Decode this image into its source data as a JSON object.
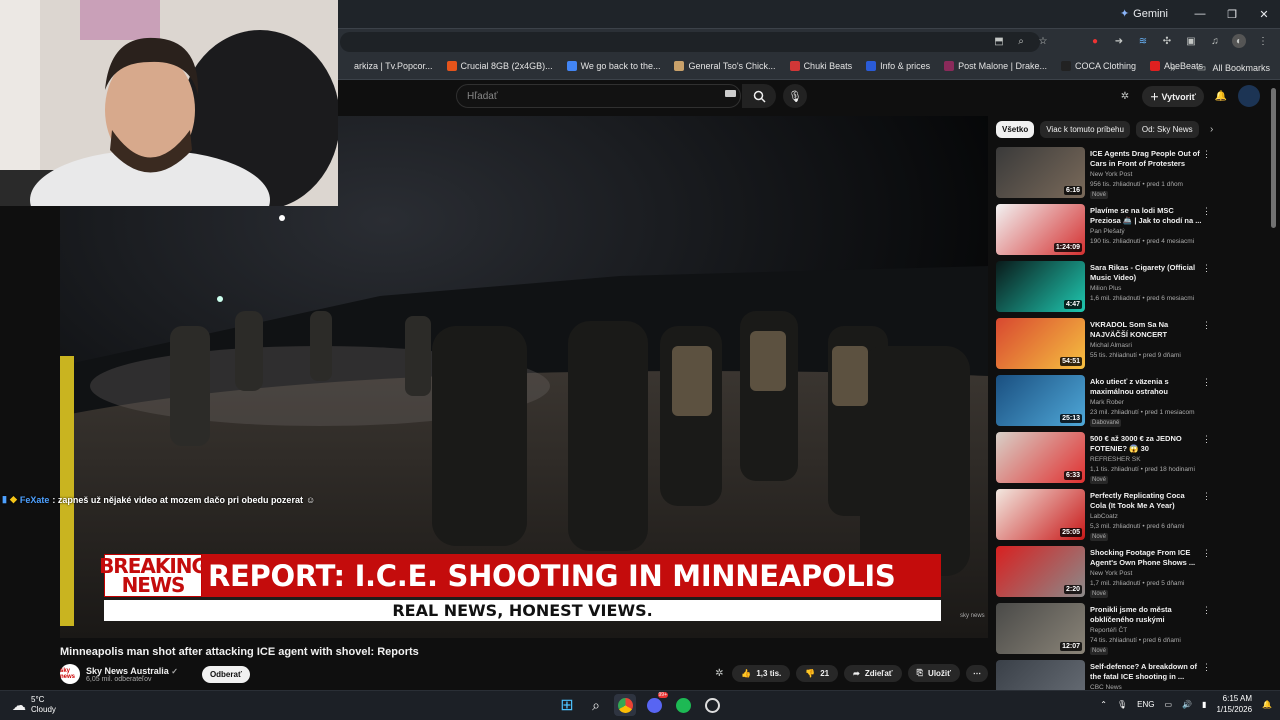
{
  "browser": {
    "gemini_label": "Gemini",
    "bookmarks": [
      {
        "label": "arkiza | Tv.Popcor...",
        "color": "#00000000"
      },
      {
        "label": "Crucial 8GB (2x4GB)...",
        "color": "#e5541b"
      },
      {
        "label": "We go back to the...",
        "color": "#4285f4"
      },
      {
        "label": "General Tso's Chick...",
        "color": "#c9a16a"
      },
      {
        "label": "Chuki Beats",
        "color": "#d23737"
      },
      {
        "label": "Info & prices",
        "color": "#2a5bd7"
      },
      {
        "label": "Post Malone | Drake...",
        "color": "#8a2a5a"
      },
      {
        "label": "COCA Clothing",
        "color": "#222222"
      },
      {
        "label": "AbeBeats",
        "color": "#e02020"
      }
    ],
    "all_bookmarks": "All Bookmarks"
  },
  "youtube": {
    "search_placeholder": "Hľadať",
    "create_label": "Vytvoriť",
    "video": {
      "breaking_line1": "BREAKING",
      "breaking_line2": "NEWS",
      "headline": "REPORT: I.C.E. SHOOTING IN MINNEAPOLIS",
      "tagline": "REAL NEWS, HONEST VIEWS.",
      "watermark": "sky news"
    },
    "chat": {
      "user": "FeXate",
      "message": ": zapneš už nějaké video at mozem dačo pri obedu pozerat"
    },
    "title": "Minneapolis man shot after attacking ICE agent with shovel: Reports",
    "channel": {
      "name": "Sky News Australia",
      "subs": "6,05 mil. odberateľov",
      "avatar_text": "sky news",
      "subscribe": "Odberať"
    },
    "actions": {
      "likes": "1,3 tis.",
      "dislikes": "21",
      "share": "Zdieľať",
      "save": "Uložiť"
    },
    "chips": [
      "Všetko",
      "Viac k tomuto príbehu",
      "Od: Sky News"
    ],
    "recommendations": [
      {
        "title": "ICE Agents Drag People Out of Cars in Front of Protesters",
        "channel": "New York Post",
        "meta": "956 tis. zhliadnutí • pred 1 dňom",
        "badge": "Nové",
        "duration": "6:16",
        "c1": "#3a3a3a",
        "c2": "#7a6a5a"
      },
      {
        "title": "Plavíme se na lodi MSC Preziosa 🚢 | Jak to chodí na ...",
        "channel": "Pan Plešatý",
        "meta": "190 tis. zhliadnutí • pred 4 mesiacmi",
        "badge": "",
        "duration": "1:24:09",
        "c1": "#f2f2f2",
        "c2": "#d43030"
      },
      {
        "title": "Sara Rikas - Cigarety (Official Music Video)",
        "channel": "Milion Plus",
        "meta": "1,6 mil. zhliadnutí • pred 6 mesiacmi",
        "badge": "",
        "duration": "4:47",
        "c1": "#0a1a1a",
        "c2": "#1fc8b0"
      },
      {
        "title": "VKRADOL Som Sa Na NAJVÄČŠÍ KONCERT SEPARA!",
        "channel": "Michal Almasri",
        "meta": "55 tis. zhliadnutí • pred 9 dňami",
        "badge": "",
        "duration": "54:51",
        "c1": "#d84830",
        "c2": "#f6c040"
      },
      {
        "title": "Ako utiecť z väzenia s maximálnou ostrahou pomoco...",
        "channel": "Mark Rober",
        "meta": "23 mil. zhliadnutí • pred 1 mesiacom",
        "badge": "Dabované",
        "duration": "25:13",
        "c1": "#1a4f80",
        "c2": "#4fa8d8"
      },
      {
        "title": "500 € až 3000 € za JEDNO FOTENIE? 😱 30 (ne)vhodných...",
        "channel": "REFRESHER SK",
        "meta": "1,1 tis. zhliadnutí • pred 18 hodinami",
        "badge": "Nové",
        "duration": "6:33",
        "c1": "#d8d0c8",
        "c2": "#e03030"
      },
      {
        "title": "Perfectly Replicating Coca Cola (It Took Me A Year)",
        "channel": "LabCoatz",
        "meta": "5,3 mil. zhliadnutí • pred 6 dňami",
        "badge": "Nové",
        "duration": "25:05",
        "c1": "#f2e8e0",
        "c2": "#c81818"
      },
      {
        "title": "Shocking Footage From ICE Agent's Own Phone Shows ...",
        "channel": "New York Post",
        "meta": "1,7 mil. zhliadnutí • pred 5 dňami",
        "badge": "Nové",
        "duration": "2:20",
        "c1": "#d82020",
        "c2": "#8a8a8a"
      },
      {
        "title": "Pronikli jsme do města obklíčeného ruskými okupanty...",
        "channel": "Reportéři ČT",
        "meta": "74 tis. zhliadnutí • pred 6 dňami",
        "badge": "Nové",
        "duration": "12:07",
        "c1": "#4a4a48",
        "c2": "#8a8478"
      },
      {
        "title": "Self-defence? A breakdown of the fatal ICE shooting in ...",
        "channel": "CBC News",
        "meta": "",
        "badge": "",
        "duration": "",
        "c1": "#3a4048",
        "c2": "#6a7078"
      }
    ]
  },
  "taskbar": {
    "temp": "5°C",
    "cond": "Cloudy",
    "lang": "ENG",
    "time": "6:15 AM",
    "date": "1/15/2026",
    "discord_badge": "99+"
  }
}
